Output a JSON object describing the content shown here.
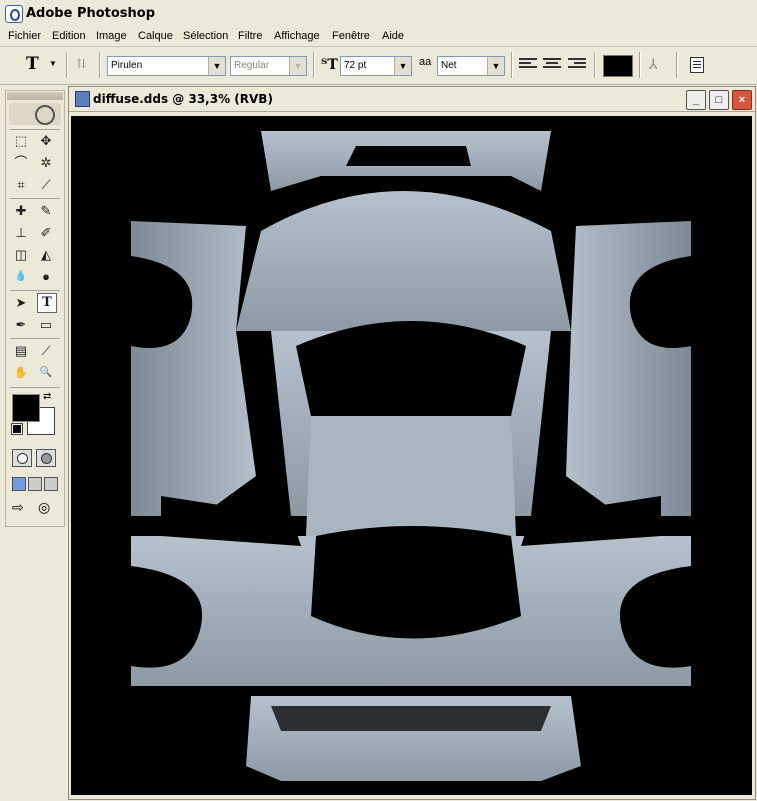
{
  "app": {
    "title": "Adobe Photoshop"
  },
  "menu": [
    "Fichier",
    "Edition",
    "Image",
    "Calque",
    "Sélection",
    "Filtre",
    "Affichage",
    "Fenêtre",
    "Aide"
  ],
  "options": {
    "tool_glyph": "T",
    "font_family": "Pirulen",
    "font_style": "Regular",
    "font_size": "72 pt",
    "antialias": "Net",
    "antialias_label": "aa",
    "text_color": "#000000"
  },
  "document": {
    "title": "diffuse.dds @ 33,3% (RVB)"
  },
  "window_buttons": {
    "minimize": "_",
    "maximize": "□",
    "close": "×"
  },
  "colors": {
    "foreground": "#000000",
    "background": "#ffffff",
    "texture": "#a4b1bd"
  },
  "tools": [
    {
      "name": "marquee",
      "glyph": "⬚"
    },
    {
      "name": "move",
      "glyph": "✥"
    },
    {
      "name": "lasso",
      "glyph": "⌒"
    },
    {
      "name": "magic-wand",
      "glyph": "✲"
    },
    {
      "name": "crop",
      "glyph": "⌗"
    },
    {
      "name": "slice",
      "glyph": "⟋"
    },
    {
      "name": "healing",
      "glyph": "✚"
    },
    {
      "name": "brush",
      "glyph": "✎"
    },
    {
      "name": "stamp",
      "glyph": "⊥"
    },
    {
      "name": "history-brush",
      "glyph": "✐"
    },
    {
      "name": "eraser",
      "glyph": "◫"
    },
    {
      "name": "bucket",
      "glyph": "◭"
    },
    {
      "name": "blur",
      "glyph": "💧"
    },
    {
      "name": "dodge",
      "glyph": "●"
    },
    {
      "name": "path-select",
      "glyph": "➤"
    },
    {
      "name": "type",
      "glyph": "T"
    },
    {
      "name": "pen",
      "glyph": "✒"
    },
    {
      "name": "shape",
      "glyph": "▭"
    },
    {
      "name": "notes",
      "glyph": "▤"
    },
    {
      "name": "eyedropper",
      "glyph": "⟋"
    },
    {
      "name": "hand",
      "glyph": "✋"
    },
    {
      "name": "zoom",
      "glyph": "🔍"
    }
  ]
}
